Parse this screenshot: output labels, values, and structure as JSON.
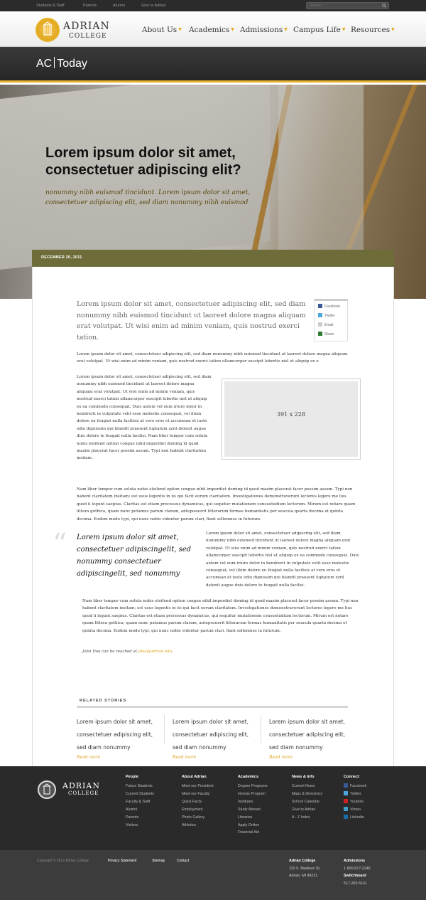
{
  "topbar": {
    "links": [
      "Students & Staff",
      "Parents",
      "Alumni",
      "Give to Adrian"
    ],
    "search_placeholder": "Search"
  },
  "header": {
    "logo_name": "ADRIAN",
    "logo_sub": "COLLEGE",
    "nav": [
      "About Us",
      "Academics",
      "Admissions",
      "Campus Life",
      "Resources"
    ]
  },
  "band": {
    "title_left": "AC",
    "title_right": "Today"
  },
  "hero": {
    "title": "Lorem ipsum dolor sit amet, consectetuer adipiscing elit?",
    "subtitle": "nonummy nibh euismod tincidunt. Lorem ipsum dolor sit amet, consectetuer adipiscing elit, sed diam nonummy nibh euismod"
  },
  "article": {
    "date": "DECEMBER 20, 2011",
    "lead": "Lorem ipsum dolor sit amet, consectetuer adipiscing elit, sed diam nonummy nibh euismod tincidunt ut laoreet dolore magna aliquam erat volutpat. Ut wisi enim ad minim veniam, quis nostrud exerci tation.",
    "para1": "Lorem ipsum dolor sit amet, consectetuer adipiscing elit, sed diam nonummy nibh euismod tincidunt ut laoreet dolore magna aliquam erat volutpat. Ut wisi enim ad minim veniam, quis nostrud exerci tation ullamcorper suscipit lobortis nisl ut aliquip ex e",
    "para2": "Lorem ipsum dolor sit amet, consectetuer adipiscing elit, sed diam nonummy nibh euismod tincidunt ut laoreet dolore magna aliquam erat volutpat. Ut wisi enim ad minim veniam, quis nostrud exerci tation ullamcorper suscipit lobortis nisl ut aliquip ex ea commodo consequat. Duis autem vel eum iriure dolor in hendrerit in vulputate velit esse molestie consequat, vel illum dolore eu feugiat nulla facilisis at vero eros et accumsan et iusto odio dignissim qui blandit praesent luptatum zzril delenit augue duis dolore te feugait nulla facilisi. Nam liber tempor cum soluta nobis eleifend option congue nihil imperdiet doming id quod mazim placerat facer possim assum. Typi non habent claritatem insitam.",
    "image_label": "391 x 228",
    "para3": "Nam liber tempor cum soluta nobis eleifend option congue nihil imperdiet doming id quod mazim placerat facer possim assum. Typi non habent claritatem insitam; est usus legentis in iis qui facit eorum claritatem. Investigationes demonstraverunt lectores legere me lius quod ii legunt saepius. Claritas est etiam processus dynamicus, qui sequitur mutationem consuetudium lectorum. Mirum est notare quam littera gothica, quam nunc putamus parum claram, anteposuerit litterarum formas humanitatis per seacula quarta decima et quinta decima. Eodem modo typi, qui nunc nobis videntur parum clari, fiant sollemnes in futurum.",
    "pullquote_mark": "“",
    "pullquote": "Lorem ipsum dolor sit amet, consectetuer adipiscingelit, sed nonummy consectetuer adipiscingelit, sed nonummy",
    "para4": "Lorem ipsum dolor sit amet, consectetuer adipiscing elit, sed diam nonummy nibh euismod tincidunt ut laoreet dolore magna aliquam erat volutpat. Ut wisi enim ad minim veniam, quis nostrud exerci tation ullamcorper suscipit lobortis nisl ut aliquip ex ea commodo consequat. Duis autem vel eum iriure dolor in hendrerit in vulputate velit esse molestie consequat, vel illum dolore eu feugiat nulla facilisis at vero eros et accumsan et iusto odio dignissim qui blandit praesent luptatum zzril delenit augue duis dolore te feugait nulla facilisi.",
    "para5": "Nam liber tempor cum soluta nobis eleifend option congue nihil imperdiet doming id quod mazim placerat facer possim assum. Typi non habent claritatem insitam; est usus legentis in iis qui facit eorum claritatem. Investigationes demonstraverunt lectores legere me lius quod ii legunt saepius. Claritas est etiam processus dynamicus, qui sequitur mutationem consuetudium lectorum. Mirum est notare quam littera gothica, quam nunc putamus parum claram, anteposuerit litterarum formas humanitatis per seacula quarta decima et quinta decima. Eodem modo typi, qui nunc nobis videntur parum clari, fiant sollemnes in futurum.",
    "contact_prefix": "John Doe can be reached at ",
    "contact_email": "jdoe@adrian.edu",
    "contact_suffix": "."
  },
  "share": {
    "items": [
      {
        "label": "Facebook",
        "icon": "facebook-icon",
        "color": "#3b5998"
      },
      {
        "label": "Twitter",
        "icon": "twitter-icon",
        "color": "#4da7de"
      },
      {
        "label": "Email",
        "icon": "email-icon",
        "color": "#cccccc"
      },
      {
        "label": "Share",
        "icon": "share-icon",
        "color": "#2e7d32"
      }
    ]
  },
  "related": {
    "title": "RELATED STORIES",
    "stories": [
      {
        "title": "Lorem ipsum dolor sit amet, consectetuer adipiscing elit, sed diam nonummy",
        "more": "Read more"
      },
      {
        "title": "Lorem ipsum dolor sit amet, consectetuer adipiscing elit, sed diam nonummy",
        "more": "Read more"
      },
      {
        "title": "Lorem ipsum dolor sit amet, consectetuer adipiscing elit, sed diam nonummy",
        "more": "Read more"
      }
    ]
  },
  "footer": {
    "logo_name": "ADRIAN",
    "logo_sub": "COLLEGE",
    "columns": [
      {
        "heading": "People",
        "links": [
          "Future Students",
          "Current Students",
          "Faculty & Staff",
          "Alumni",
          "Parents",
          "Visitors"
        ]
      },
      {
        "heading": "About Adrian",
        "links": [
          "Meet our President",
          "Meet our Faculty",
          "Quick Facts",
          "Employment",
          "Photo Gallery",
          "Athletics"
        ]
      },
      {
        "heading": "Academics",
        "links": [
          "Degree Programs",
          "Honors Program",
          "Institutes",
          "Study Abroad",
          "Libraries",
          "Apply Online",
          "Financial Aid"
        ]
      },
      {
        "heading": "News & Info",
        "links": [
          "Current News",
          "Maps & Directions",
          "School Calendar",
          "Give to Adrian",
          "A - Z Index"
        ]
      },
      {
        "heading": "Connect",
        "links": [
          "Facebook",
          "Twitter",
          "Youtube",
          "Vimeo",
          "Linkedin"
        ]
      }
    ],
    "connect_colors": [
      "#3b5998",
      "#4da7de",
      "#cc2222",
      "#3aa0c8",
      "#1a6ea8"
    ]
  },
  "bottombar": {
    "copyright": "Copyright © 2012 Adrian College",
    "links": [
      "Privacy Statement",
      "Sitemap",
      "Contact"
    ],
    "address_head": "Adrian College",
    "address_lines": [
      "110 S. Madison St.",
      "Adrian, MI 49221"
    ],
    "admissions_head": "Admissions",
    "admissions_phone": "1-800-877-2246",
    "switchboard_head": "Switchboard",
    "switchboard_phone": "517-265-5161"
  }
}
